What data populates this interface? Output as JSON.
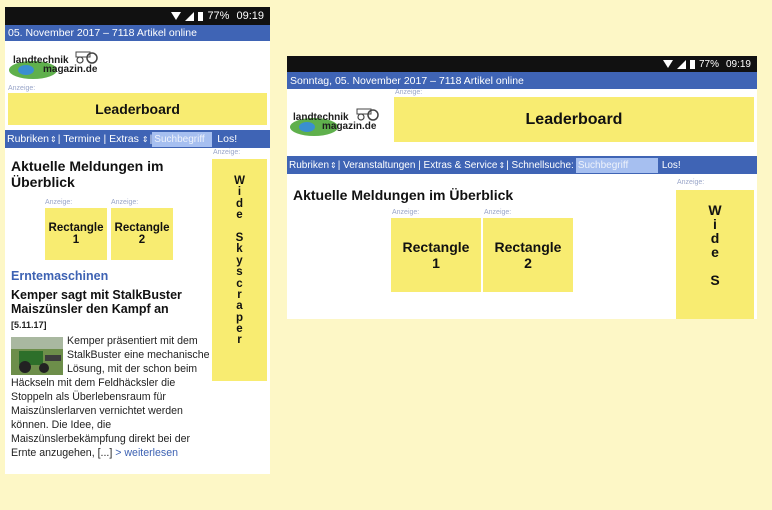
{
  "status": {
    "battery": "77%",
    "time": "09:19"
  },
  "portrait": {
    "date_line": "05. November 2017 – 7118 Artikel online",
    "logo": {
      "line1": "landtechnik",
      "line2": "magazin.de"
    },
    "ad_label": "Anzeige:",
    "leaderboard": "Leaderboard",
    "nav": {
      "rubriken": "Rubriken",
      "sep1": "| Termine | Extras",
      "sep2": "|",
      "search_placeholder": "Suchbegriff",
      "submit": "Los!"
    },
    "heading": "Aktuelle Meldungen im Überblick",
    "rect1": {
      "label": "Anzeige:",
      "line1": "Rectangle",
      "line2": "1"
    },
    "rect2": {
      "label": "Anzeige:",
      "line1": "Rectangle",
      "line2": "2"
    },
    "skyscraper": {
      "label": "Anzeige:",
      "letters": [
        "W",
        "i",
        "d",
        "e",
        "",
        "S",
        "k",
        "y",
        "s",
        "c",
        "r",
        "a",
        "p",
        "e",
        "r"
      ]
    },
    "category": "Erntemaschinen",
    "article": {
      "title": "Kemper sagt mit StalkBuster Maiszünsler den Kampf an",
      "date": "[5.11.17]",
      "body": "Kemper präsentiert mit dem StalkBuster eine mechanische Lösung, mit der schon beim Häckseln mit dem Feldhäcksler die Stoppeln als Überlebensraum für Maiszünslerlarven vernichtet werden können. Die Idee, die Maiszünslerbekämpfung direkt bei der Ernte anzugehen, [...]",
      "more": "> weiterlesen"
    }
  },
  "landscape": {
    "date_line": "Sonntag, 05. November 2017 – 7118 Artikel online",
    "logo": {
      "line1": "landtechnik",
      "line2": "magazin.de"
    },
    "ad_label": "Anzeige:",
    "leaderboard": "Leaderboard",
    "nav": {
      "rubriken": "Rubriken",
      "middle": "| Veranstaltungen | Extras & Service",
      "schnell": "| Schnellsuche:",
      "search_placeholder": "Suchbegriff",
      "submit": "Los!"
    },
    "heading": "Aktuelle Meldungen im Überblick",
    "rect1": {
      "label": "Anzeige:",
      "line1": "Rectangle",
      "line2": "1"
    },
    "rect2": {
      "label": "Anzeige:",
      "line1": "Rectangle",
      "line2": "2"
    },
    "skyscraper": {
      "label": "Anzeige:",
      "letters": [
        "W",
        "i",
        "d",
        "e",
        "",
        "S"
      ]
    }
  }
}
